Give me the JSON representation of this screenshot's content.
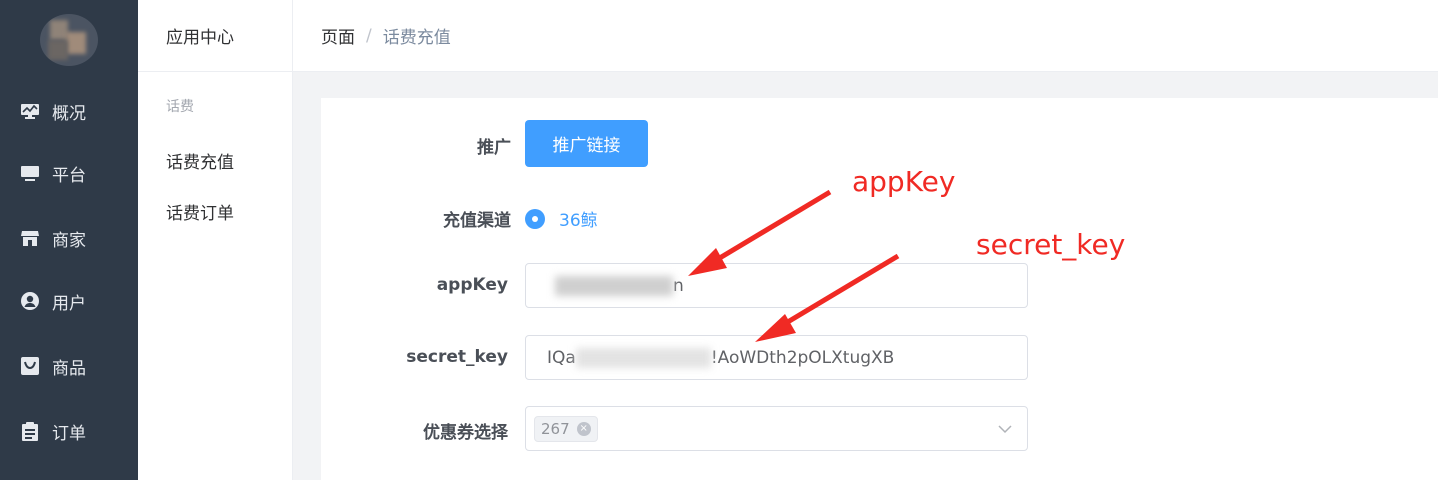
{
  "sidebar": {
    "items": [
      {
        "label": "概况",
        "icon": "dashboard-icon"
      },
      {
        "label": "平台",
        "icon": "monitor-icon"
      },
      {
        "label": "商家",
        "icon": "store-icon"
      },
      {
        "label": "用户",
        "icon": "user-icon"
      },
      {
        "label": "商品",
        "icon": "product-icon"
      },
      {
        "label": "订单",
        "icon": "order-icon"
      }
    ]
  },
  "submenu": {
    "title": "应用中心",
    "group": "话费",
    "items": [
      {
        "label": "话费充值"
      },
      {
        "label": "话费订单"
      }
    ]
  },
  "breadcrumb": {
    "home": "页面",
    "separator": "/",
    "current": "话费充值"
  },
  "form": {
    "promote": {
      "label": "推广",
      "button": "推广链接"
    },
    "channel": {
      "label": "充值渠道",
      "option": "36鲸"
    },
    "appkey": {
      "label": "appKey",
      "value_visible_suffix": "n"
    },
    "secret_key": {
      "label": "secret_key",
      "value_prefix": "IQa",
      "value_suffix": "!AoWDth2pOLXtugXB"
    },
    "coupon": {
      "label": "优惠券选择",
      "tag": "267",
      "close_icon": "close-circle-icon",
      "dropdown_icon": "chevron-down-icon"
    }
  },
  "annotations": {
    "appkey": "appKey",
    "secret_key": "secret_key"
  },
  "colors": {
    "sidebar_bg": "#2f3a48",
    "primary": "#409eff",
    "annotation": "#f02a24"
  }
}
